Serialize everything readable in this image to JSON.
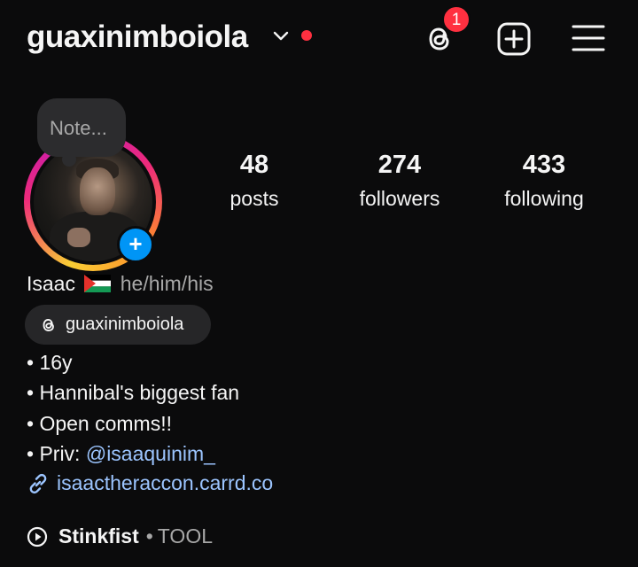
{
  "header": {
    "username": "guaxinimboiola",
    "threads_badge_count": "1",
    "icons": [
      "chevron-down-icon",
      "threads-icon",
      "add-post-icon",
      "menu-icon"
    ],
    "accent_colors": {
      "notification": "#ff3040",
      "primary_blue": "#0095f6",
      "link": "#9cc5ff"
    }
  },
  "profile": {
    "note_placeholder": "Note...",
    "stats": [
      {
        "count": "48",
        "label": "posts"
      },
      {
        "count": "274",
        "label": "followers"
      },
      {
        "count": "433",
        "label": "following"
      }
    ],
    "name": "Isaac",
    "flag_icon": "palestine-flag-icon",
    "pronouns": "he/him/his",
    "threads_handle": "guaxinimboiola",
    "bio_lines": [
      "• 16y",
      "• Hannibal's biggest fan",
      "• Open comms!!"
    ],
    "priv_prefix": "• Priv: ",
    "priv_mention": "@isaaquinim_",
    "link": "isaactheraccon.carrd.co",
    "music": {
      "song": "Stinkfist",
      "separator": "•",
      "artist": "TOOL"
    }
  }
}
